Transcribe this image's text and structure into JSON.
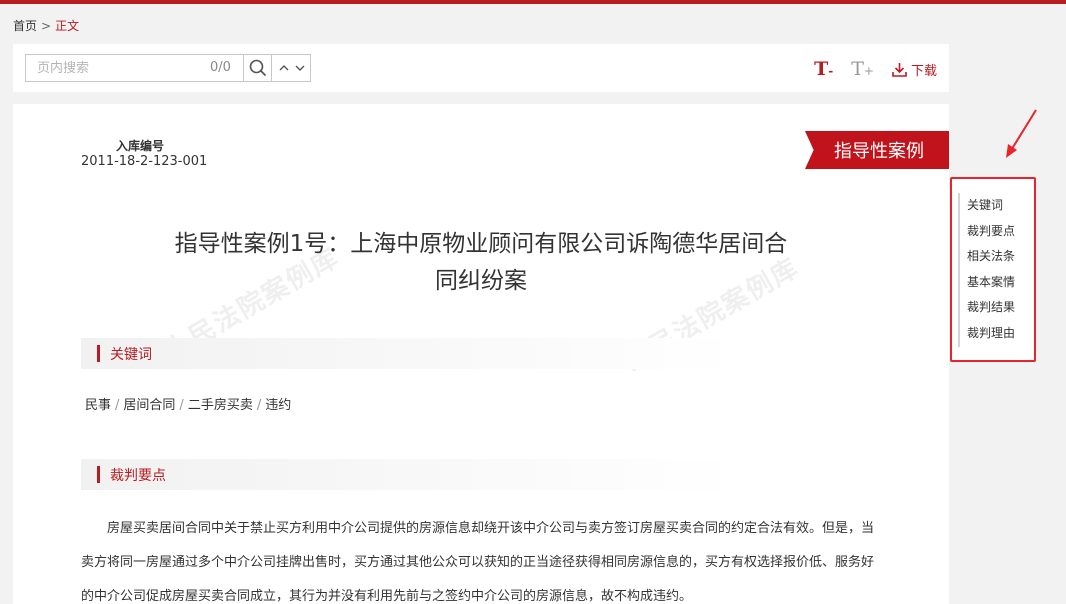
{
  "breadcrumb": {
    "home": "首页",
    "separator": ">",
    "current": "正文"
  },
  "toolbar": {
    "search_placeholder": "页内搜索",
    "search_count": "0/0",
    "font_decrease": "T",
    "font_decrease_sign": "-",
    "font_increase": "T",
    "font_increase_sign": "+",
    "download_label": "下载"
  },
  "case": {
    "number_label": "入库编号",
    "number_value": "2011-18-2-123-001",
    "ribbon": "指导性案例",
    "title_line1": "指导性案例1号：上海中原物业顾问有限公司诉陶德华居间合",
    "title_line2": "同纠纷案",
    "watermark": "人民法院案例库"
  },
  "sections": {
    "keywords_title": "关键词",
    "keywords": [
      "民事",
      "居间合同",
      "二手房买卖",
      "违约"
    ],
    "keyword_sep": "/",
    "ruling_title": "裁判要点",
    "ruling_text": "房屋买卖居间合同中关于禁止买方利用中介公司提供的房源信息却绕开该中介公司与卖方签订房屋买卖合同的约定合法有效。但是，当卖方将同一房屋通过多个中介公司挂牌出售时，买方通过其他公众可以获知的正当途径获得相同房源信息的，买方有权选择报价低、服务好的中介公司促成房屋买卖合同成立，其行为并没有利用先前与之签约中介公司的房源信息，故不构成违约。"
  },
  "side_nav": {
    "items": [
      "关键词",
      "裁判要点",
      "相关法条",
      "基本案情",
      "裁判结果",
      "裁判理由"
    ]
  },
  "colors": {
    "accent": "#b81c22",
    "highlight": "#e8242d"
  }
}
